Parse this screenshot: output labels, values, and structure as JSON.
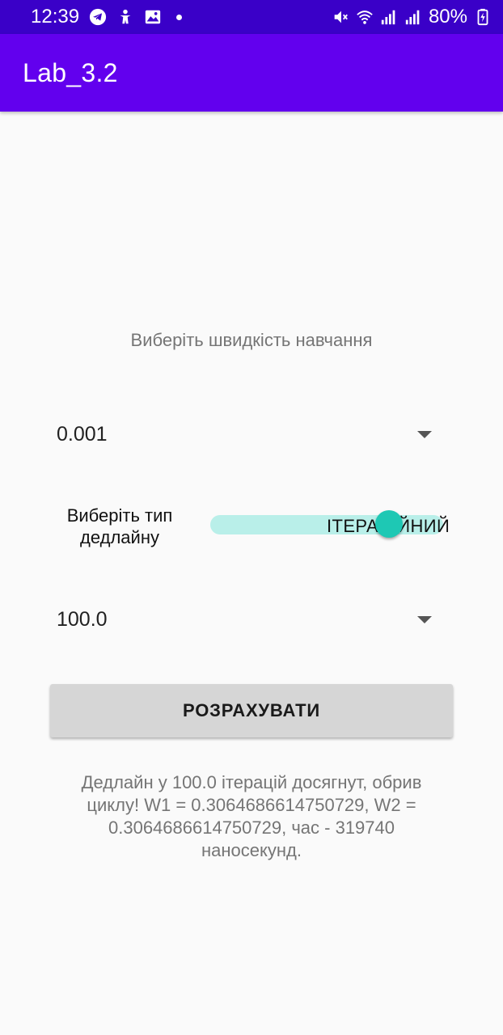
{
  "status_bar": {
    "time": "12:39",
    "battery": "80%",
    "left_icons": [
      "telegram-icon",
      "accessibility-icon",
      "gallery-icon"
    ],
    "right_icons": [
      "mute-icon",
      "wifi-icon",
      "signal-icon",
      "signal-icon",
      "battery-charging-icon"
    ]
  },
  "app_bar": {
    "title": "Lab_3.2"
  },
  "main": {
    "learning_rate_prompt": "Виберіть швидкість навчання",
    "learning_rate_value": "0.001",
    "deadline_type_label": "Виберіть тип дедлайну",
    "deadline_switch_text": "ІТЕРАЦІЙНИЙ",
    "deadline_switch_on": true,
    "deadline_value": "100.0",
    "calculate_button": "РОЗРАХУВАТИ",
    "result": "Дедлайн у 100.0 ітерацій досягнут, обрив циклу! W1 = 0.3064686614750729, W2 = 0.3064686614750729, час - 319740 наносекунд."
  },
  "colors": {
    "status_bar": "#3a00c8",
    "app_bar": "#6200ee",
    "switch_thumb": "#1ec8b4",
    "switch_track": "#b9efe9",
    "button": "#d6d6d6"
  }
}
